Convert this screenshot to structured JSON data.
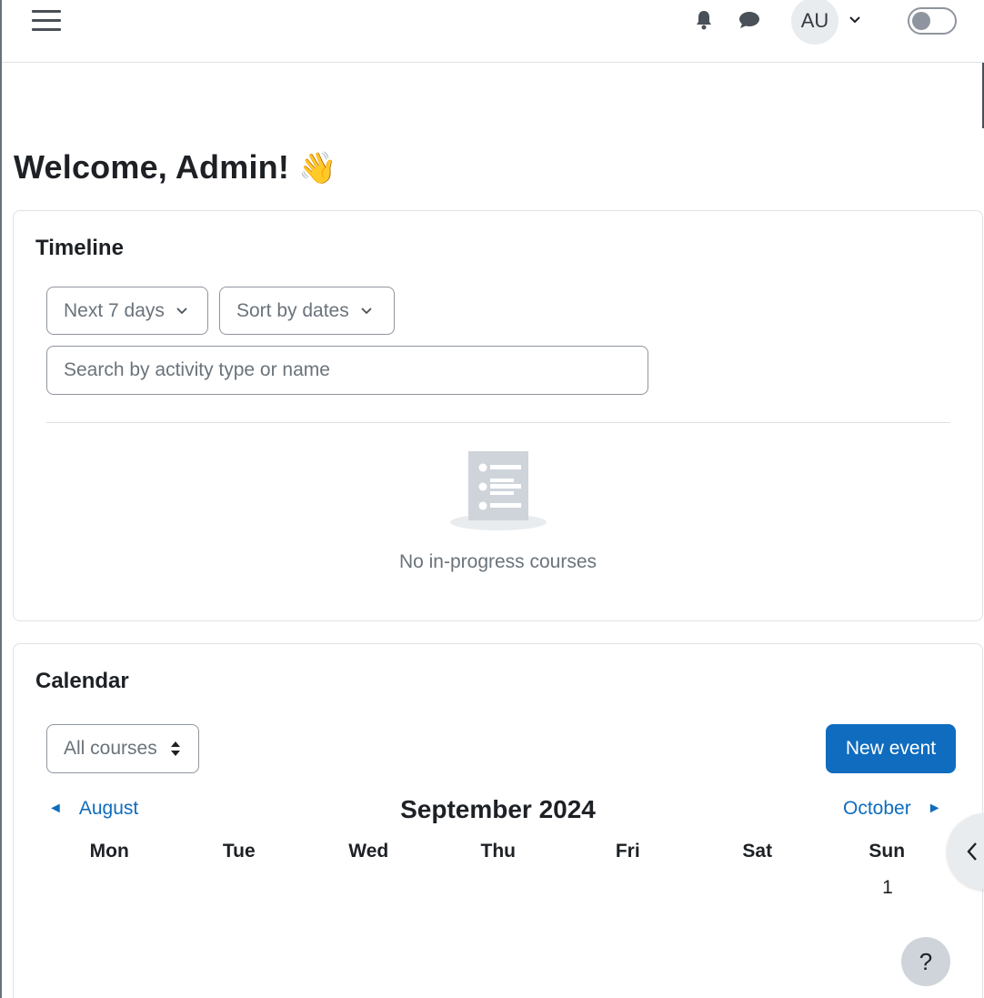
{
  "navbar": {
    "menu_icon": "hamburger-menu-icon",
    "notifications_icon": "bell-icon",
    "messages_icon": "chat-bubble-icon",
    "avatar_initials": "AU",
    "avatar_caret_icon": "chevron-down-icon",
    "mode_toggle_icon": "toggle-switch-icon"
  },
  "page": {
    "title": "Welcome, Admin!",
    "title_emoji": "👋"
  },
  "timeline": {
    "title": "Timeline",
    "range_filter": "Next 7 days",
    "sort_filter": "Sort by dates",
    "search_placeholder": "Search by activity type or name",
    "empty_icon": "empty-list-icon",
    "empty_text": "No in-progress courses"
  },
  "calendar": {
    "title": "Calendar",
    "course_filter": "All courses",
    "new_event_label": "New event",
    "prev_month": "August",
    "prev_arrow": "◄",
    "current_month": "September 2024",
    "next_month": "October",
    "next_arrow": "►",
    "weekdays": [
      "Mon",
      "Tue",
      "Wed",
      "Thu",
      "Fri",
      "Sat",
      "Sun"
    ],
    "first_day": "1"
  },
  "floating": {
    "drawer_icon": "chevron-left-icon",
    "help_label": "?"
  },
  "colors": {
    "accent": "#0f6cbf",
    "text": "#1d2125",
    "muted": "#6a737b",
    "border": "#dee2e6"
  }
}
